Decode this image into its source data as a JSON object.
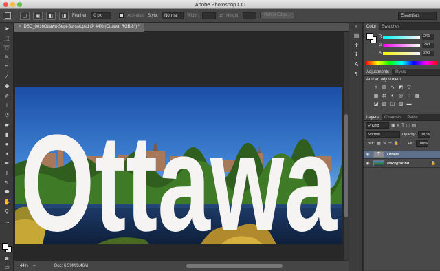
{
  "window": {
    "title": "Adobe Photoshop CC"
  },
  "options": {
    "feather_label": "Feather:",
    "feather_value": "0 px",
    "antialias_label": "Anti-alias",
    "style_label": "Style:",
    "style_value": "Normal",
    "width_label": "Width:",
    "height_label": "Height:",
    "refine_label": "Refine Edge...",
    "workspace": "Essentials"
  },
  "document": {
    "tab_title": "DSC_0016Ottawa-Sept-Sunset.psd @ 44% (Ottawa, RGB/8*) *",
    "overlay_text": "Ottawa"
  },
  "status": {
    "zoom": "44%",
    "doc_info": "Doc: 6.59M/8.46M"
  },
  "color_panel": {
    "tabs": [
      "Color",
      "Swatches"
    ],
    "r_value": "246",
    "g_value": "243",
    "b_value": "243",
    "fg_color": "#ffffff",
    "bg_color": "#f6f3f3"
  },
  "adjustments_panel": {
    "tabs": [
      "Adjustments",
      "Styles"
    ],
    "heading": "Add an adjustment"
  },
  "layers_panel": {
    "tabs": [
      "Layers",
      "Channels",
      "Paths"
    ],
    "filter_kind": "Kind",
    "blend_mode": "Normal",
    "opacity_label": "Opacity:",
    "opacity_value": "100%",
    "lock_label": "Lock:",
    "fill_label": "Fill:",
    "fill_value": "100%",
    "layers": [
      {
        "name": "Ottawa",
        "selected": true
      },
      {
        "name": "Background",
        "selected": false
      }
    ]
  },
  "colors": {
    "ui_dark": "#2b2b2b",
    "panel": "#494949",
    "selection": "#5d6f8a",
    "text_fill": "#f6f3f3"
  }
}
